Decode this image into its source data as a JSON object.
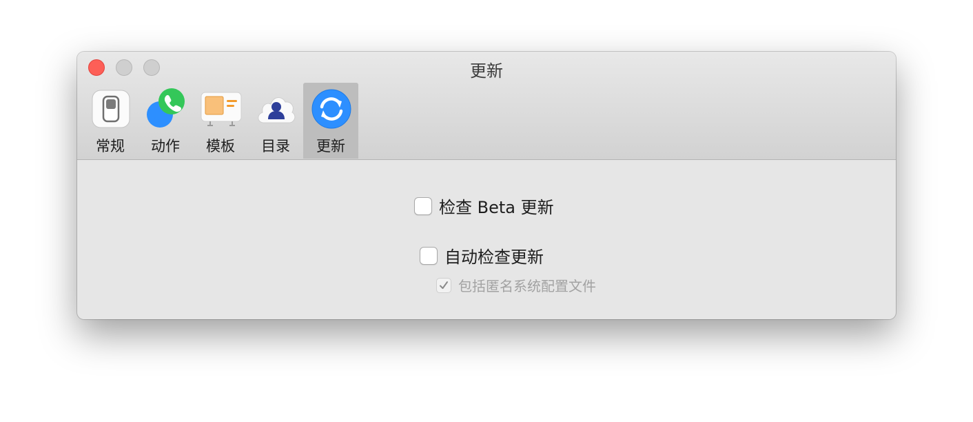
{
  "window": {
    "title": "更新"
  },
  "toolbar": {
    "items": [
      {
        "label": "常规",
        "icon": "switch-icon"
      },
      {
        "label": "动作",
        "icon": "phone-chat-icon"
      },
      {
        "label": "模板",
        "icon": "template-icon"
      },
      {
        "label": "目录",
        "icon": "contacts-icon"
      },
      {
        "label": "更新",
        "icon": "refresh-icon",
        "selected": true
      }
    ]
  },
  "settings": {
    "check_beta": {
      "label": "检查 Beta 更新",
      "checked": false
    },
    "auto_check": {
      "label": "自动检查更新",
      "checked": false
    },
    "include_profile": {
      "label": "包括匿名系统配置文件",
      "checked": true,
      "enabled": false
    }
  },
  "colors": {
    "close": "#fd5f57",
    "accent_blue": "#2d8fff",
    "green": "#34c759",
    "selected_tab": "#bdbdbd"
  }
}
